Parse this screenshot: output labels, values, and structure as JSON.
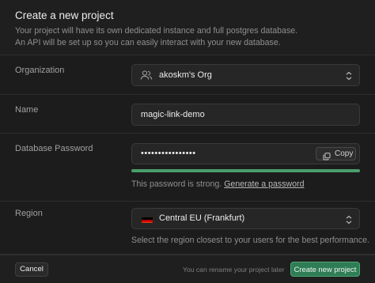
{
  "header": {
    "title": "Create a new project",
    "subtitle_line1": "Your project will have its own dedicated instance and full postgres database.",
    "subtitle_line2": "An API will be set up so you can easily interact with your new database."
  },
  "organization": {
    "label": "Organization",
    "value": "akoskm's Org",
    "icon": "users-icon"
  },
  "name": {
    "label": "Name",
    "value": "magic-link-demo"
  },
  "password": {
    "label": "Database Password",
    "value": "••••••••••••••••",
    "copy_label": "Copy",
    "strength": 1.0,
    "strength_color": "#4a9e6b",
    "strength_text": "This password is strong.",
    "generate_label": "Generate a password"
  },
  "region": {
    "label": "Region",
    "value": "Central EU (Frankfurt)",
    "flag_icon": "germany-flag-icon",
    "hint": "Select the region closest to your users for the best performance."
  },
  "footer": {
    "cancel_label": "Cancel",
    "note": "You can rename your project later",
    "create_label": "Create new project",
    "accent": "#2e7d55"
  }
}
